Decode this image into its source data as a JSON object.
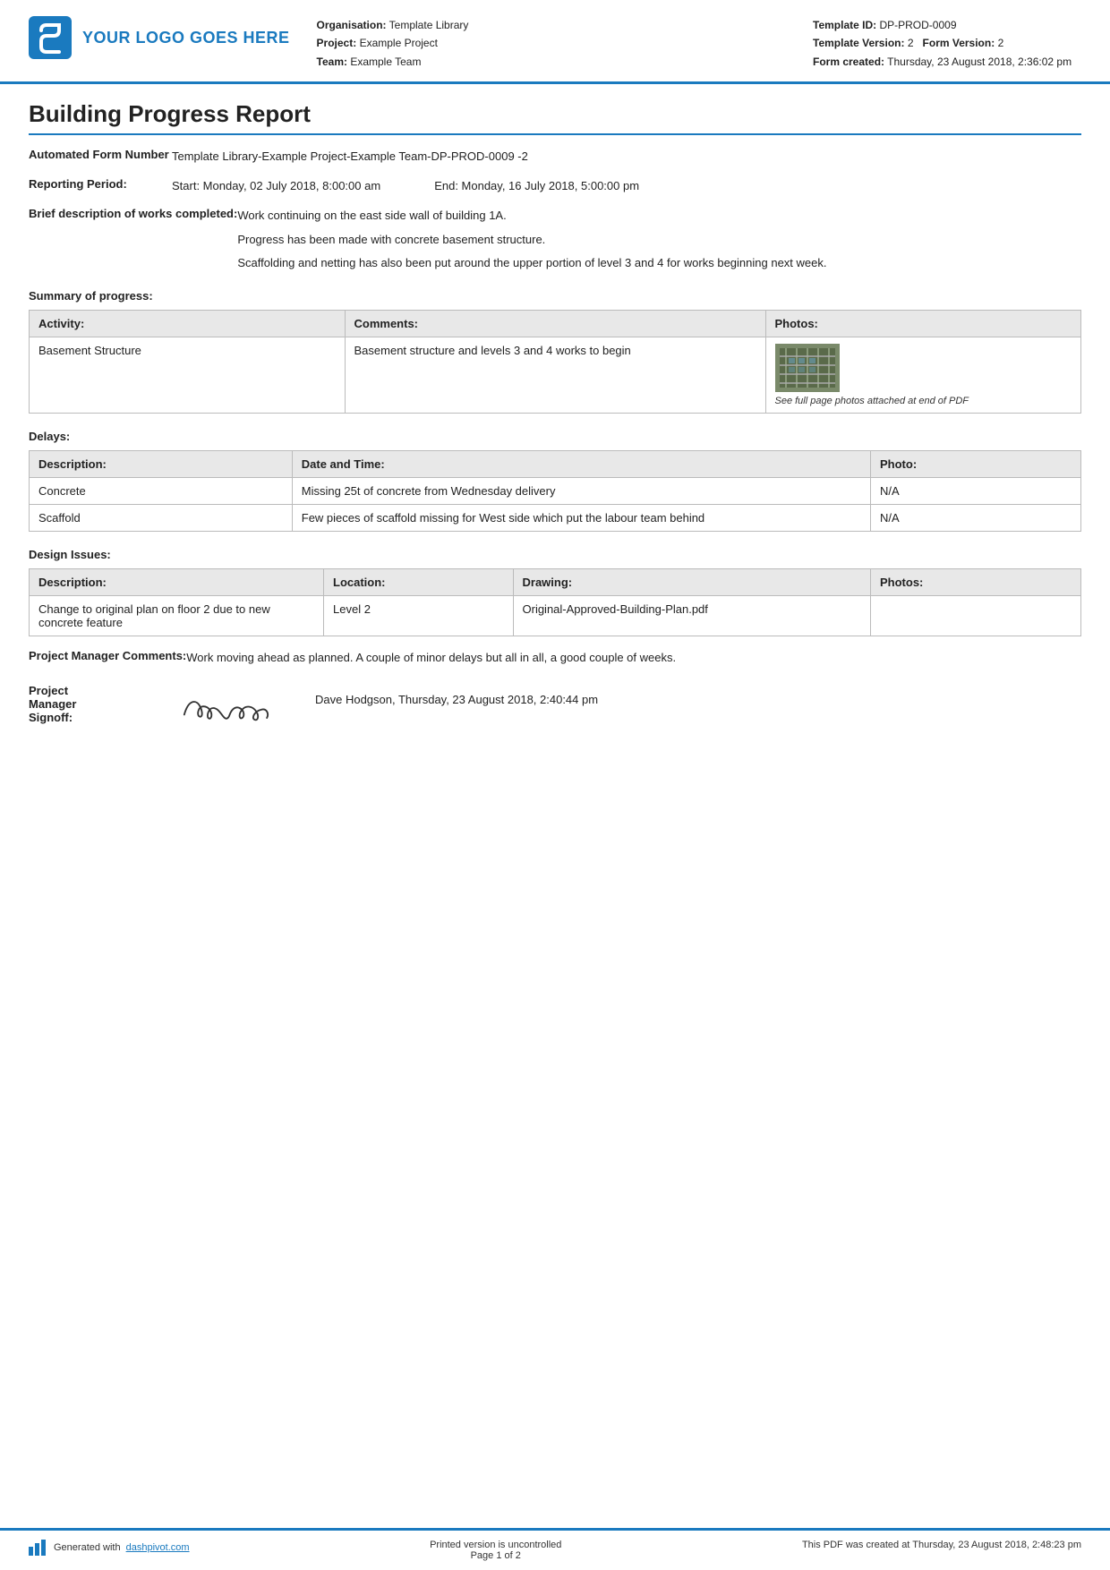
{
  "header": {
    "logo_text": "YOUR LOGO GOES HERE",
    "org_label": "Organisation:",
    "org_value": "Template Library",
    "project_label": "Project:",
    "project_value": "Example Project",
    "team_label": "Team:",
    "team_value": "Example Team",
    "template_id_label": "Template ID:",
    "template_id_value": "DP-PROD-0009",
    "template_version_label": "Template Version:",
    "template_version_value": "2",
    "form_version_label": "Form Version:",
    "form_version_value": "2",
    "form_created_label": "Form created:",
    "form_created_value": "Thursday, 23 August 2018, 2:36:02 pm"
  },
  "report": {
    "title": "Building Progress Report",
    "automated_form_label": "Automated Form Number",
    "automated_form_value": "Template Library-Example Project-Example Team-DP-PROD-0009   -2",
    "reporting_period_label": "Reporting Period:",
    "reporting_start": "Start: Monday, 02 July 2018, 8:00:00 am",
    "reporting_end": "End: Monday, 16 July 2018, 5:00:00 pm",
    "brief_desc_label": "Brief description of works completed:",
    "brief_desc_lines": [
      "Work continuing on the east side wall of building 1A.",
      "Progress has been made with concrete basement structure.",
      "Scaffolding and netting has also been put around the upper portion of level 3 and 4 for works beginning next week."
    ],
    "summary_heading": "Summary of progress:",
    "summary_table": {
      "headers": [
        "Activity:",
        "Comments:",
        "Photos:"
      ],
      "rows": [
        {
          "activity": "Basement Structure",
          "comments": "Basement structure and levels 3 and 4 works to begin",
          "photo_caption": "See full page photos attached at end of PDF"
        }
      ]
    },
    "delays_heading": "Delays:",
    "delays_table": {
      "headers": [
        "Description:",
        "Date and Time:",
        "Photo:"
      ],
      "rows": [
        {
          "description": "Concrete",
          "date_time": "Missing 25t of concrete from Wednesday delivery",
          "photo": "N/A"
        },
        {
          "description": "Scaffold",
          "date_time": "Few pieces of scaffold missing for West side which put the labour team behind",
          "photo": "N/A"
        }
      ]
    },
    "design_issues_heading": "Design Issues:",
    "design_issues_table": {
      "headers": [
        "Description:",
        "Location:",
        "Drawing:",
        "Photos:"
      ],
      "rows": [
        {
          "description": "Change to original plan on floor 2 due to new concrete feature",
          "location": "Level 2",
          "drawing": "Original-Approved-Building-Plan.pdf",
          "photos": ""
        }
      ]
    },
    "pm_comments_label": "Project Manager Comments:",
    "pm_comments_value": "Work moving ahead as planned. A couple of minor delays but all in all, a good couple of weeks.",
    "pm_signoff_label": "Project Manager Signoff:",
    "pm_signoff_details": "Dave Hodgson, Thursday, 23 August 2018, 2:40:44 pm"
  },
  "footer": {
    "generated_text": "Generated with ",
    "generated_link": "dashpivot.com",
    "uncontrolled_text": "Printed version is uncontrolled",
    "page_text": "Page 1 of 2",
    "created_text": "This PDF was created at Thursday, 23 August 2018, 2:48:23 pm"
  }
}
